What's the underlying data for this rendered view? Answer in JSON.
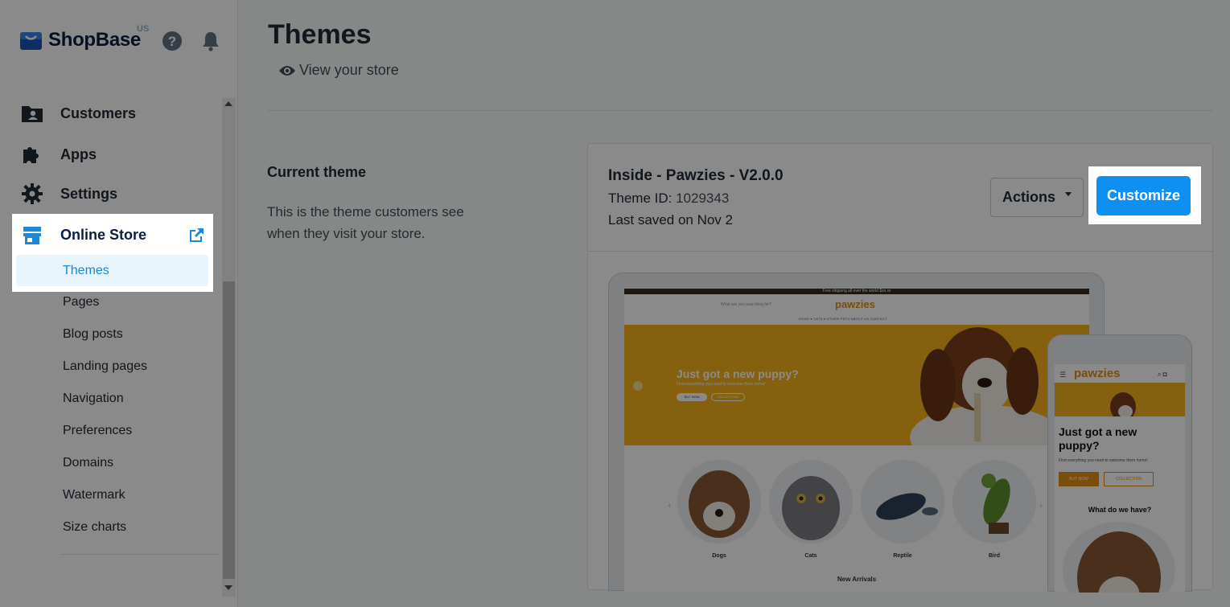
{
  "brand": {
    "name": "ShopBase",
    "region": "US"
  },
  "sidebar": {
    "nav": [
      {
        "label": "Customers",
        "icon": "customers-icon"
      },
      {
        "label": "Apps",
        "icon": "puzzle-icon"
      },
      {
        "label": "Settings",
        "icon": "gear-icon"
      }
    ],
    "online_store": {
      "label": "Online Store",
      "icon": "store-icon"
    },
    "sub_items": [
      "Themes",
      "Pages",
      "Blog posts",
      "Landing pages",
      "Navigation",
      "Preferences",
      "Domains",
      "Watermark",
      "Size charts"
    ],
    "active_sub": "Themes"
  },
  "page": {
    "title": "Themes",
    "view_store": "View your store"
  },
  "current_theme": {
    "heading": "Current theme",
    "description": "This is the theme customers see when they visit your store.",
    "name": "Inside - Pawzies - V2.0.0",
    "id_label": "Theme ID:",
    "id_value": "1029343",
    "saved": "Last saved on Nov 2",
    "actions_label": "Actions",
    "customize_label": "Customize"
  },
  "preview": {
    "promo": "Free shipping all over the world $xx.xx",
    "search_placeholder": "What are you searching for?",
    "logo": "pawzies",
    "nav": "DOGS ▾   CATS ▾   OTHER PETS   ABOUT US   CONTACT",
    "hero_title": "Just got a new puppy?",
    "hero_sub": "Find everything you need to welcome them home!",
    "buy_now": "BUY NOW",
    "collection": "COLLECTION",
    "categories": [
      "Dogs",
      "Cats",
      "Reptile",
      "Bird"
    ],
    "new_arrivals": "New Arrivals",
    "mobile_title": "Just got a new puppy?",
    "mobile_sub": "Find everything you need to welcome them home!",
    "mobile_what": "What do we have?"
  },
  "colors": {
    "accent": "#0e8ff2",
    "active_bg": "#e8f4fc",
    "active_text": "#1a8ad6",
    "overlay": "rgba(0,0,0,0.46)"
  }
}
